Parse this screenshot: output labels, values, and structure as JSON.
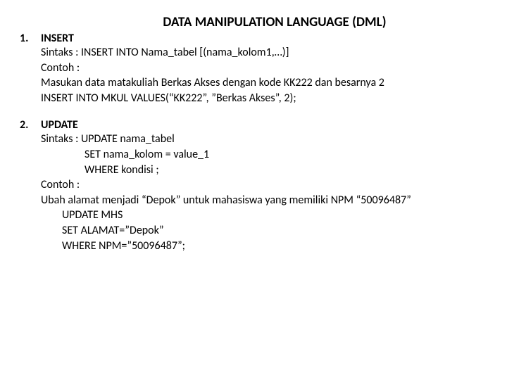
{
  "title": "DATA MANIPULATION LANGUAGE (DML)",
  "items": [
    {
      "number": "1.",
      "heading": "INSERT",
      "lines": [
        {
          "text": "Sintaks : INSERT INTO Nama_tabel [(nama_kolom1,…)]",
          "indent": ""
        },
        {
          "text": "Contoh :",
          "indent": ""
        },
        {
          "text": "Masukan data matakuliah Berkas Akses dengan kode KK222  dan besarnya 2",
          "indent": ""
        },
        {
          "text": "INSERT INTO MKUL VALUES(“KK222”, ”Berkas Akses”, 2);",
          "indent": ""
        }
      ]
    },
    {
      "number": "2.",
      "heading": "UPDATE",
      "lines": [
        {
          "text": "Sintaks : UPDATE nama_tabel",
          "indent": ""
        },
        {
          "text": "SET  nama_kolom = value_1",
          "indent": "indent1"
        },
        {
          "text": "WHERE kondisi ;",
          "indent": "indent1"
        },
        {
          "text": "Contoh :",
          "indent": ""
        },
        {
          "text": "Ubah alamat menjadi “Depok” untuk mahasiswa yang memiliki NPM “50096487”",
          "indent": ""
        },
        {
          "text": "UPDATE MHS",
          "indent": "indent2"
        },
        {
          "text": "SET ALAMAT=”Depok”",
          "indent": "indent2"
        },
        {
          "text": "WHERE NPM=”50096487”;",
          "indent": "indent2"
        }
      ]
    }
  ]
}
